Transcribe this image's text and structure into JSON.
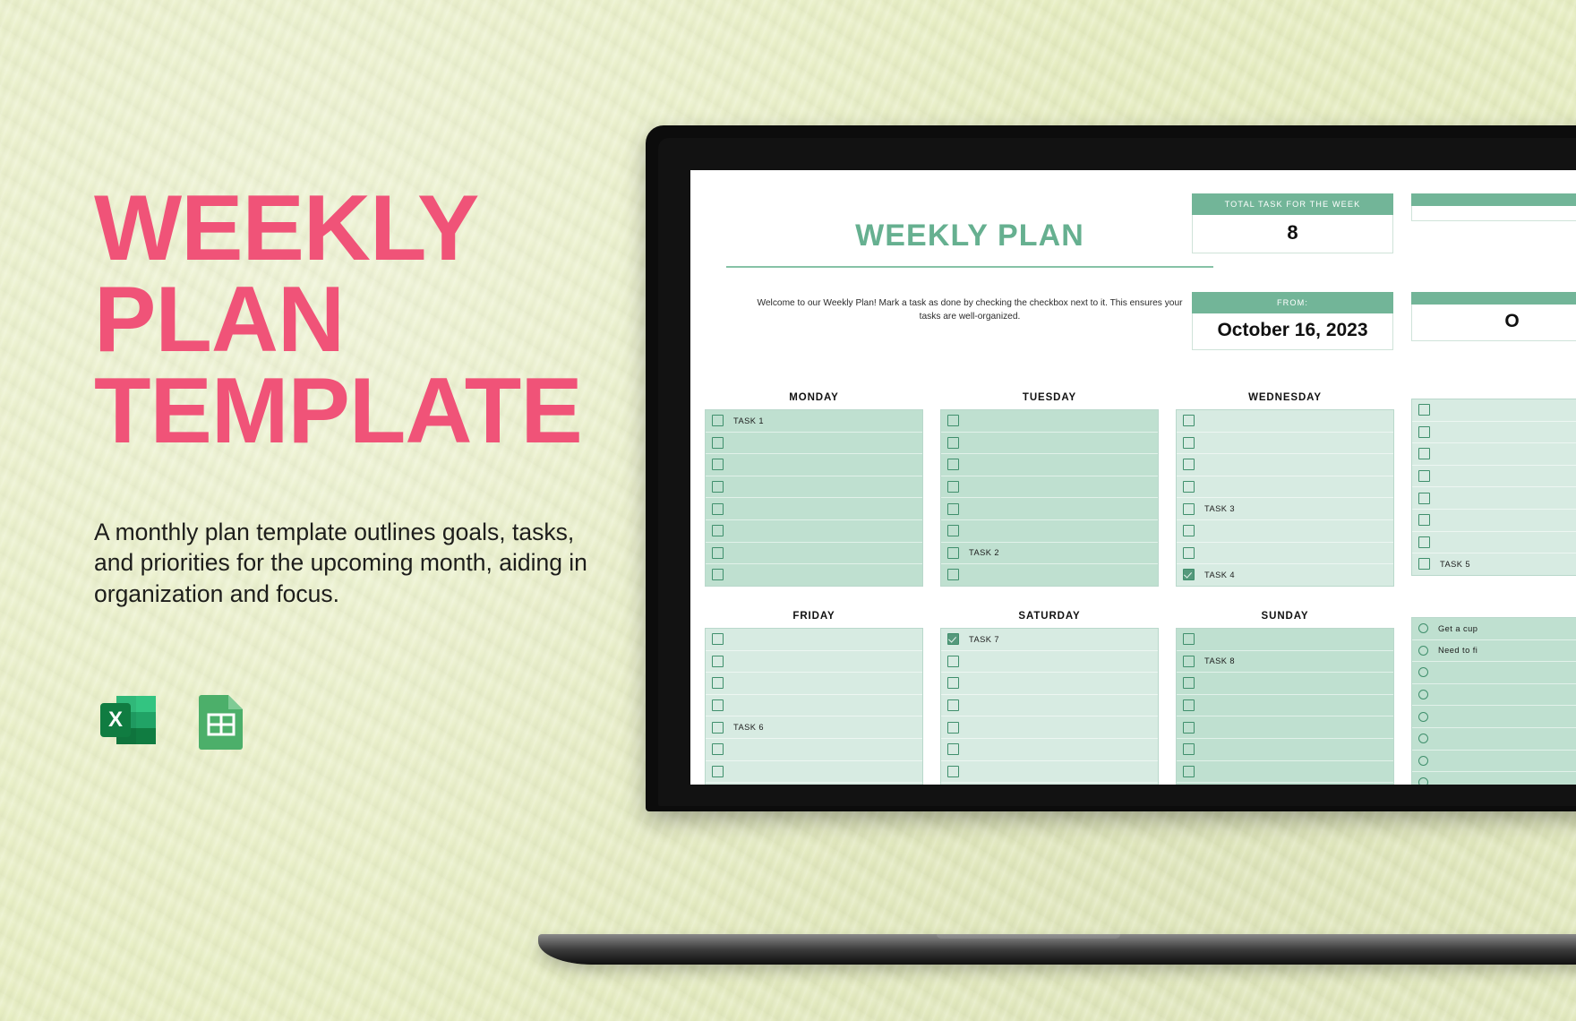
{
  "page": {
    "background_color": "#e7eec2",
    "accent_pink": "#f05378",
    "accent_green": "#72b598"
  },
  "left_panel": {
    "headline_lines": [
      "WEEKLY",
      "PLAN",
      "TEMPLATE"
    ],
    "description": "A monthly plan template outlines goals, tasks, and priorities for the upcoming month, aiding in organization and focus.",
    "file_format_badges": [
      {
        "name": "excel-icon",
        "label": "X"
      },
      {
        "name": "google-sheets-icon",
        "label": ""
      }
    ]
  },
  "spreadsheet": {
    "title": "WEEKLY PLAN",
    "welcome_text": "Welcome to our Weekly Plan! Mark a task as done by checking the checkbox next to it. This ensures your tasks are well-organized.",
    "kpis": [
      {
        "label": "TOTAL TASK FOR THE WEEK",
        "value": "8"
      },
      {
        "label": "",
        "value": ""
      }
    ],
    "date_range": [
      {
        "label": "FROM:",
        "value": "October 16, 2023"
      },
      {
        "label": "",
        "value": "O"
      }
    ],
    "days_row1": [
      {
        "name": "MONDAY",
        "shade": "dark",
        "tasks": [
          {
            "label": "TASK 1",
            "checked": false
          },
          {
            "label": "",
            "checked": false
          },
          {
            "label": "",
            "checked": false
          },
          {
            "label": "",
            "checked": false
          },
          {
            "label": "",
            "checked": false
          },
          {
            "label": "",
            "checked": false
          },
          {
            "label": "",
            "checked": false
          },
          {
            "label": "",
            "checked": false
          }
        ]
      },
      {
        "name": "TUESDAY",
        "shade": "dark",
        "tasks": [
          {
            "label": "",
            "checked": false
          },
          {
            "label": "",
            "checked": false
          },
          {
            "label": "",
            "checked": false
          },
          {
            "label": "",
            "checked": false
          },
          {
            "label": "",
            "checked": false
          },
          {
            "label": "",
            "checked": false
          },
          {
            "label": "TASK 2",
            "checked": false
          },
          {
            "label": "",
            "checked": false
          }
        ]
      },
      {
        "name": "WEDNESDAY",
        "shade": "light",
        "tasks": [
          {
            "label": "",
            "checked": false
          },
          {
            "label": "",
            "checked": false
          },
          {
            "label": "",
            "checked": false
          },
          {
            "label": "",
            "checked": false
          },
          {
            "label": "TASK 3",
            "checked": false
          },
          {
            "label": "",
            "checked": false
          },
          {
            "label": "",
            "checked": false
          },
          {
            "label": "TASK 4",
            "checked": true
          }
        ]
      },
      {
        "name": "",
        "shade": "light",
        "tasks": [
          {
            "label": "",
            "checked": false
          },
          {
            "label": "",
            "checked": false
          },
          {
            "label": "",
            "checked": false
          },
          {
            "label": "",
            "checked": false
          },
          {
            "label": "",
            "checked": false
          },
          {
            "label": "",
            "checked": false
          },
          {
            "label": "",
            "checked": false
          },
          {
            "label": "TASK 5",
            "checked": false
          }
        ]
      }
    ],
    "days_row2": [
      {
        "name": "FRIDAY",
        "shade": "light",
        "tasks": [
          {
            "label": "",
            "checked": false
          },
          {
            "label": "",
            "checked": false
          },
          {
            "label": "",
            "checked": false
          },
          {
            "label": "",
            "checked": false
          },
          {
            "label": "TASK 6",
            "checked": false
          },
          {
            "label": "",
            "checked": false
          },
          {
            "label": "",
            "checked": false
          },
          {
            "label": "",
            "checked": false
          }
        ]
      },
      {
        "name": "SATURDAY",
        "shade": "light",
        "tasks": [
          {
            "label": "TASK 7",
            "checked": true
          },
          {
            "label": "",
            "checked": false
          },
          {
            "label": "",
            "checked": false
          },
          {
            "label": "",
            "checked": false
          },
          {
            "label": "",
            "checked": false
          },
          {
            "label": "",
            "checked": false
          },
          {
            "label": "",
            "checked": false
          },
          {
            "label": "",
            "checked": false
          }
        ]
      },
      {
        "name": "SUNDAY",
        "shade": "dark",
        "tasks": [
          {
            "label": "",
            "checked": false
          },
          {
            "label": "TASK 8",
            "checked": false
          },
          {
            "label": "",
            "checked": false
          },
          {
            "label": "",
            "checked": false
          },
          {
            "label": "",
            "checked": false
          },
          {
            "label": "",
            "checked": false
          },
          {
            "label": "",
            "checked": false
          },
          {
            "label": "",
            "checked": false
          }
        ]
      },
      {
        "name": "",
        "shade": "dark",
        "bullet": "circle",
        "tasks": [
          {
            "label": "Get a cup",
            "checked": false
          },
          {
            "label": "Need to fi",
            "checked": false
          },
          {
            "label": "",
            "checked": false
          },
          {
            "label": "",
            "checked": false
          },
          {
            "label": "",
            "checked": false
          },
          {
            "label": "",
            "checked": false
          },
          {
            "label": "",
            "checked": false
          },
          {
            "label": "",
            "checked": false
          }
        ]
      }
    ]
  }
}
